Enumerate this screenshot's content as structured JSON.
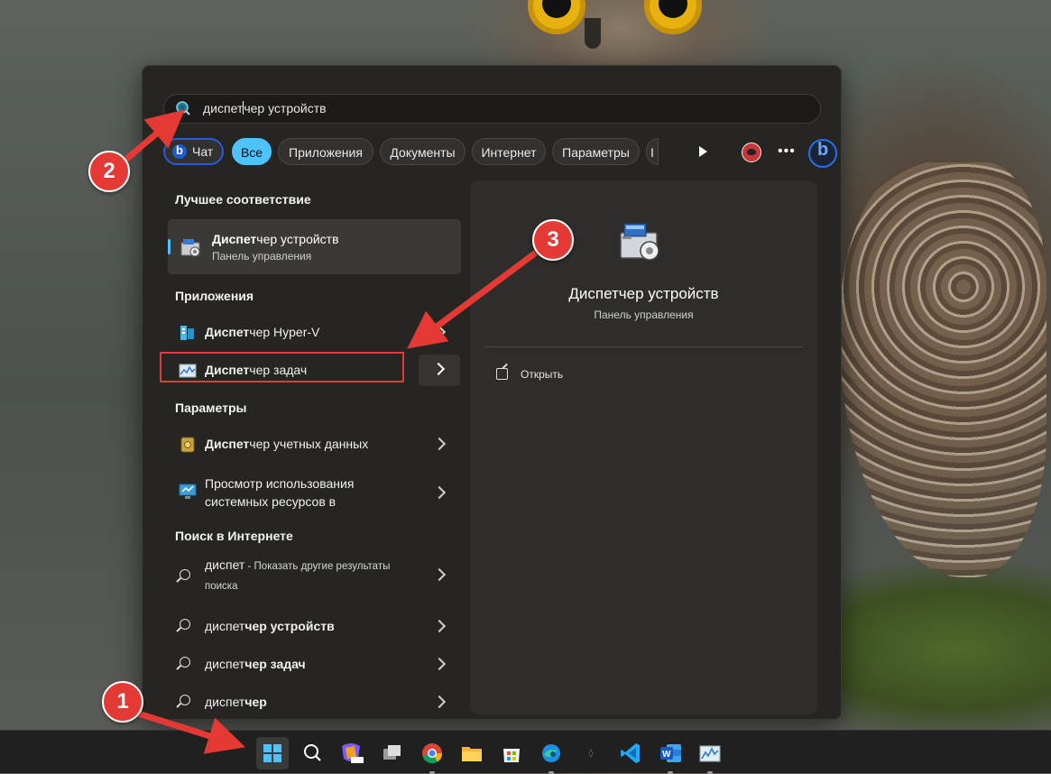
{
  "search": {
    "typed": "диспет",
    "suggestion_rest": "чер устройств"
  },
  "filters": {
    "chat": "Чат",
    "all": "Все",
    "apps": "Приложения",
    "documents": "Документы",
    "internet": "Интернет",
    "settings": "Параметры",
    "cut_off": "I"
  },
  "best_match": {
    "section_title": "Лучшее соответствие",
    "name_bold": "Диспет",
    "name_rest": "чер устройств",
    "subtitle": "Панель управления"
  },
  "apps": {
    "section_title": "Приложения",
    "items": [
      {
        "bold": "Диспет",
        "rest": "чер Hyper-V"
      },
      {
        "bold": "Диспет",
        "rest": "чер задач"
      }
    ]
  },
  "settings_section": {
    "section_title": "Параметры",
    "items": [
      {
        "bold": "Диспет",
        "rest": "чер учетных данных"
      },
      {
        "line1": "Просмотр использования",
        "line2": "системных ресурсов в"
      }
    ]
  },
  "web": {
    "section_title": "Поиск в Интернете",
    "items": [
      {
        "query": "диспет",
        "suffix": " - Показать другие результаты",
        "suffix2": "поиска"
      },
      {
        "plain": "диспет",
        "bold": "чер устройств"
      },
      {
        "plain": "диспет",
        "bold": "чер задач"
      },
      {
        "plain": "диспет",
        "bold": "чер"
      }
    ]
  },
  "details": {
    "title": "Диспетчер устройств",
    "subtitle": "Панель управления",
    "open_label": "Открыть"
  },
  "annotations": {
    "badge1": "1",
    "badge2": "2",
    "badge3": "3"
  },
  "colors": {
    "accent": "#4cc2ff",
    "annotation_red": "#e53935"
  },
  "taskbar_icons": [
    "windows-start-icon",
    "search-icon",
    "copilot-pre-icon",
    "task-view-icon",
    "chrome-icon",
    "file-explorer-icon",
    "microsoft-store-icon",
    "edge-icon",
    "unknown-app-icon",
    "vscode-icon",
    "word-icon",
    "task-manager-icon"
  ]
}
